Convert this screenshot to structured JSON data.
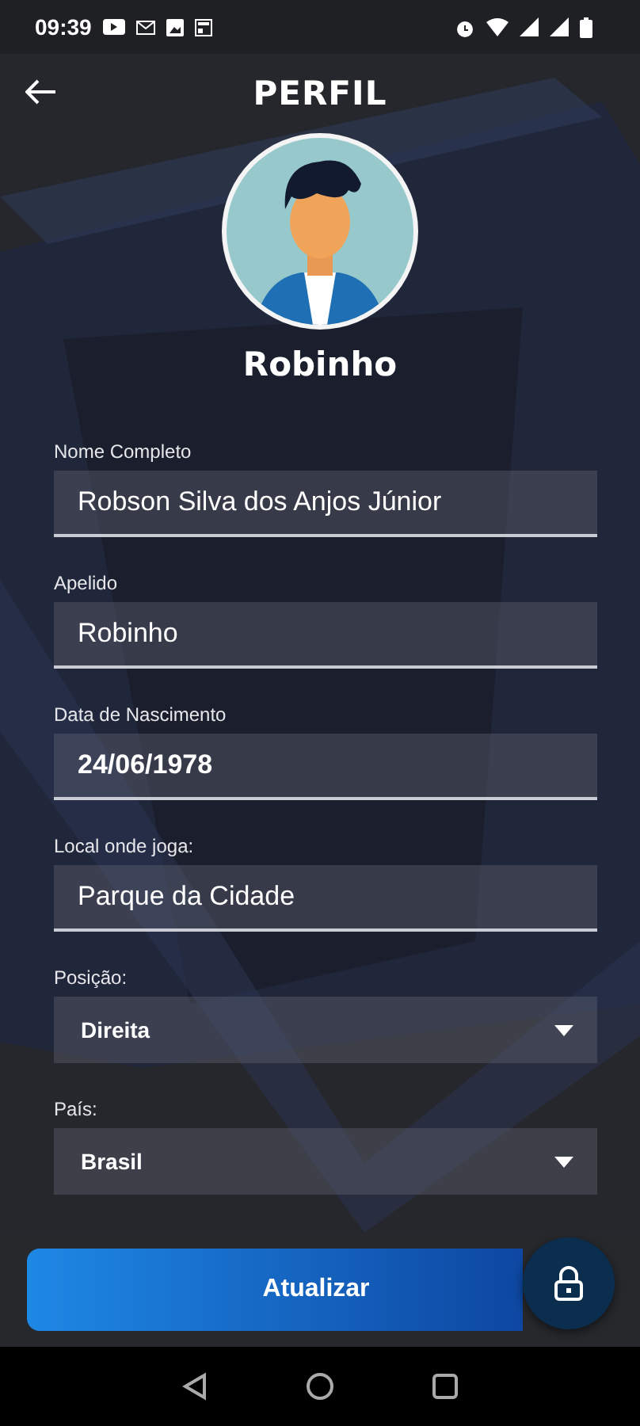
{
  "status_bar": {
    "time": "09:39"
  },
  "header": {
    "title": "PERFIL"
  },
  "profile": {
    "name": "Robinho"
  },
  "fields": [
    {
      "kind": "text",
      "label": "Nome Completo",
      "value": "Robson Silva dos Anjos Júnior"
    },
    {
      "kind": "text",
      "label": "Apelido",
      "value": "Robinho"
    },
    {
      "kind": "date",
      "label": "Data de Nascimento",
      "value": "24/06/1978"
    },
    {
      "kind": "text",
      "label": "Local onde joga:",
      "value": "Parque da Cidade"
    },
    {
      "kind": "select",
      "label": "Posição:",
      "value": "Direita"
    },
    {
      "kind": "select",
      "label": "País:",
      "value": "Brasil"
    }
  ],
  "update_button": {
    "label": "Atualizar"
  }
}
